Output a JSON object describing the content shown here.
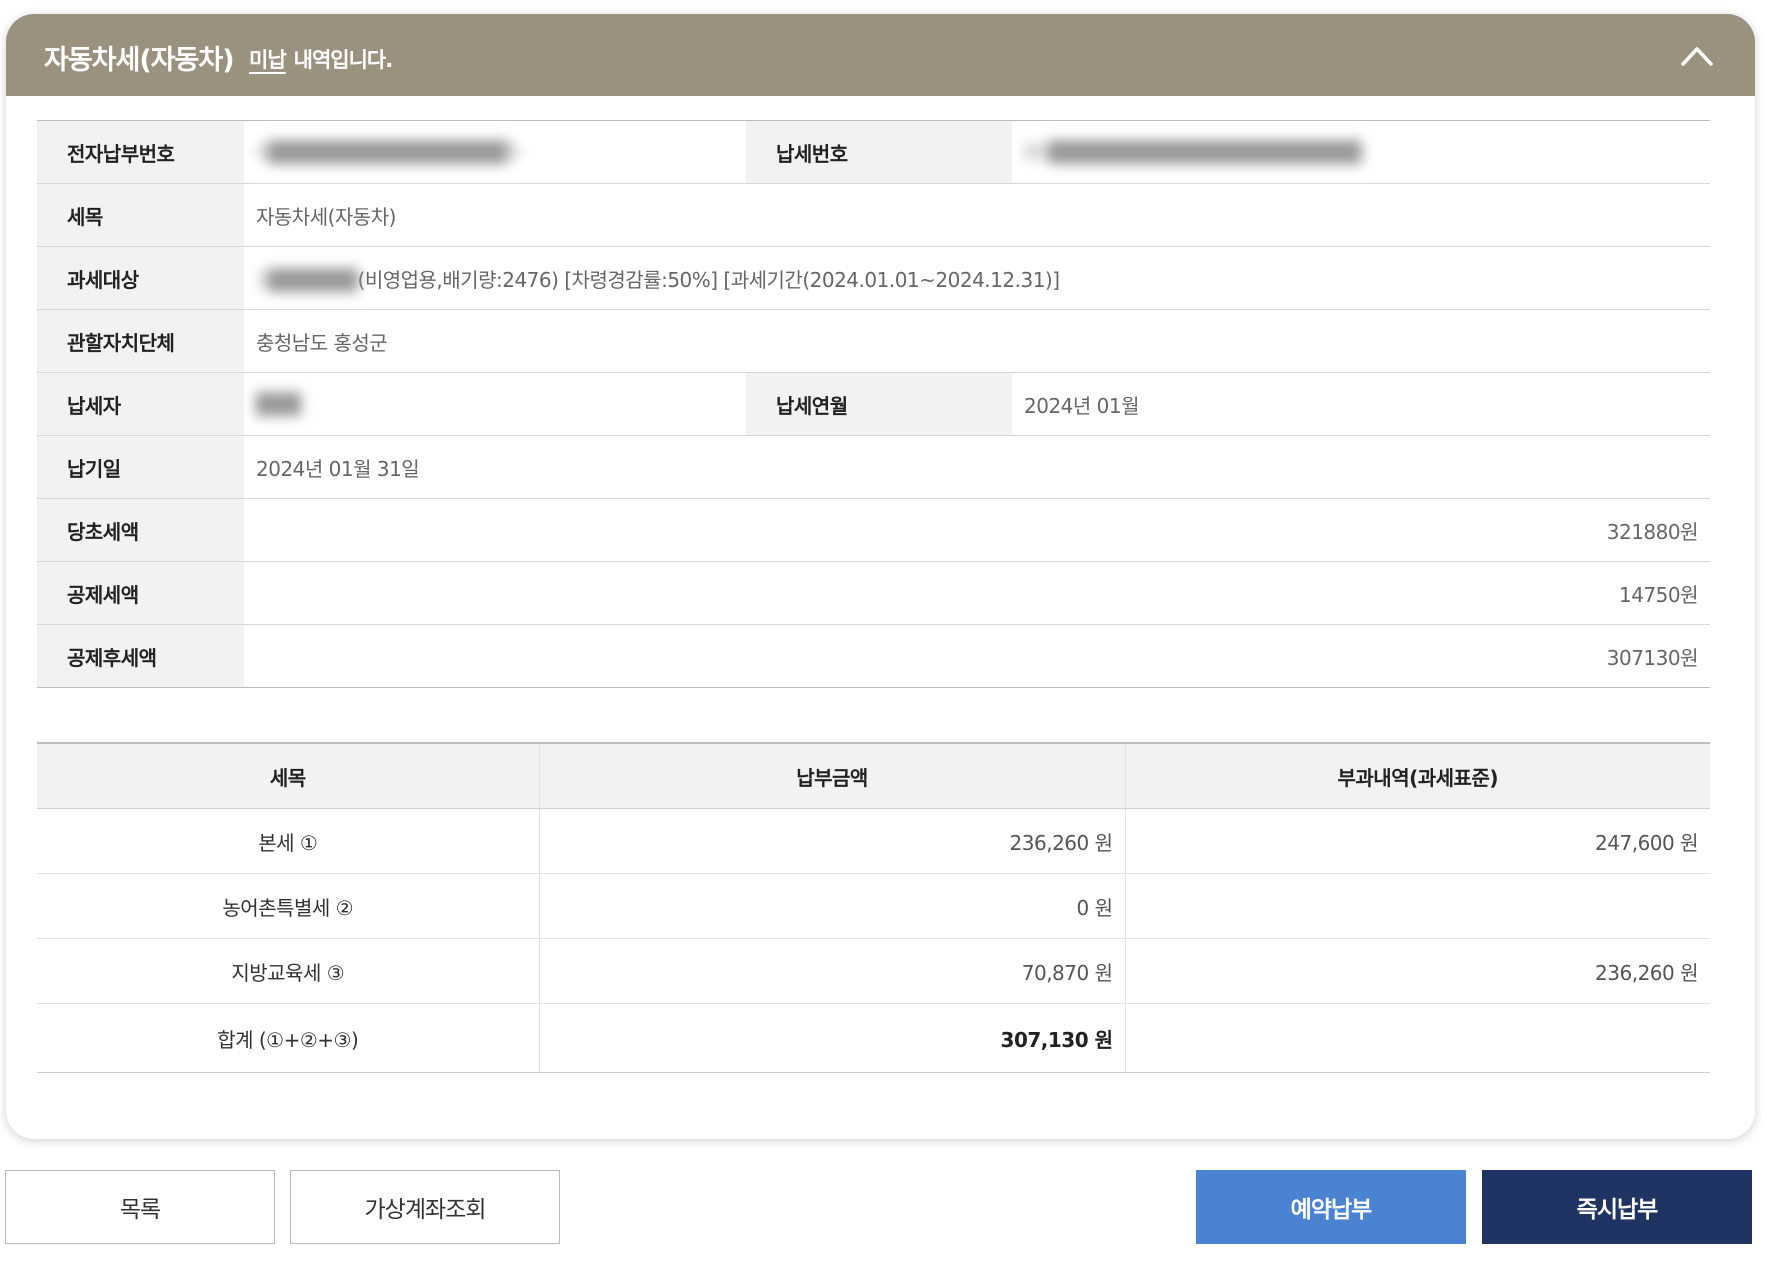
{
  "header": {
    "title": "자동차세(자동차)",
    "status_word": "미납",
    "subtitle_suffix": "내역입니다."
  },
  "info": {
    "e_payment_no_label": "전자납부번호",
    "e_payment_no_value": "4████████████████9",
    "tax_no_label": "납세번호",
    "tax_no_value": "80█████████████████████",
    "tax_item_label": "세목",
    "tax_item_value": "자동차세(자동차)",
    "target_label": "과세대상",
    "target_plate": "3██████",
    "target_value": "(비영업용,배기량:2476) [차령경감률:50%] [과세기간(2024.01.01~2024.12.31)]",
    "authority_label": "관할자치단체",
    "authority_value": "충청남도 홍성군",
    "taxpayer_label": "납세자",
    "taxpayer_value": "███",
    "tax_month_label": "납세연월",
    "tax_month_value": "2024년 01월",
    "due_label": "납기일",
    "due_value": "2024년 01월 31일",
    "original_label": "당초세액",
    "original_value": "321880원",
    "deduction_label": "공제세액",
    "deduction_value": "14750원",
    "after_label": "공제후세액",
    "after_value": "307130원"
  },
  "tax_table": {
    "headers": [
      "세목",
      "납부금액",
      "부과내역(과세표준)"
    ],
    "rows": [
      {
        "name": "본세 ①",
        "amount": "236,260 원",
        "basis": "247,600 원"
      },
      {
        "name": "농어촌특별세 ②",
        "amount": "0 원",
        "basis": ""
      },
      {
        "name": "지방교육세 ③",
        "amount": "70,870 원",
        "basis": "236,260 원"
      },
      {
        "name": "합계 (①+②+③)",
        "amount": "307,130 원",
        "basis": ""
      }
    ]
  },
  "buttons": {
    "list": "목록",
    "virtual_account": "가상계좌조회",
    "scheduled_payment": "예약납부",
    "instant_payment": "즉시납부"
  },
  "colors": {
    "header_bg": "#9b917f",
    "scheduled_btn": "#4b82d1",
    "instant_btn": "#1f3463"
  },
  "icons": {
    "collapse": "chevron-up-icon"
  }
}
